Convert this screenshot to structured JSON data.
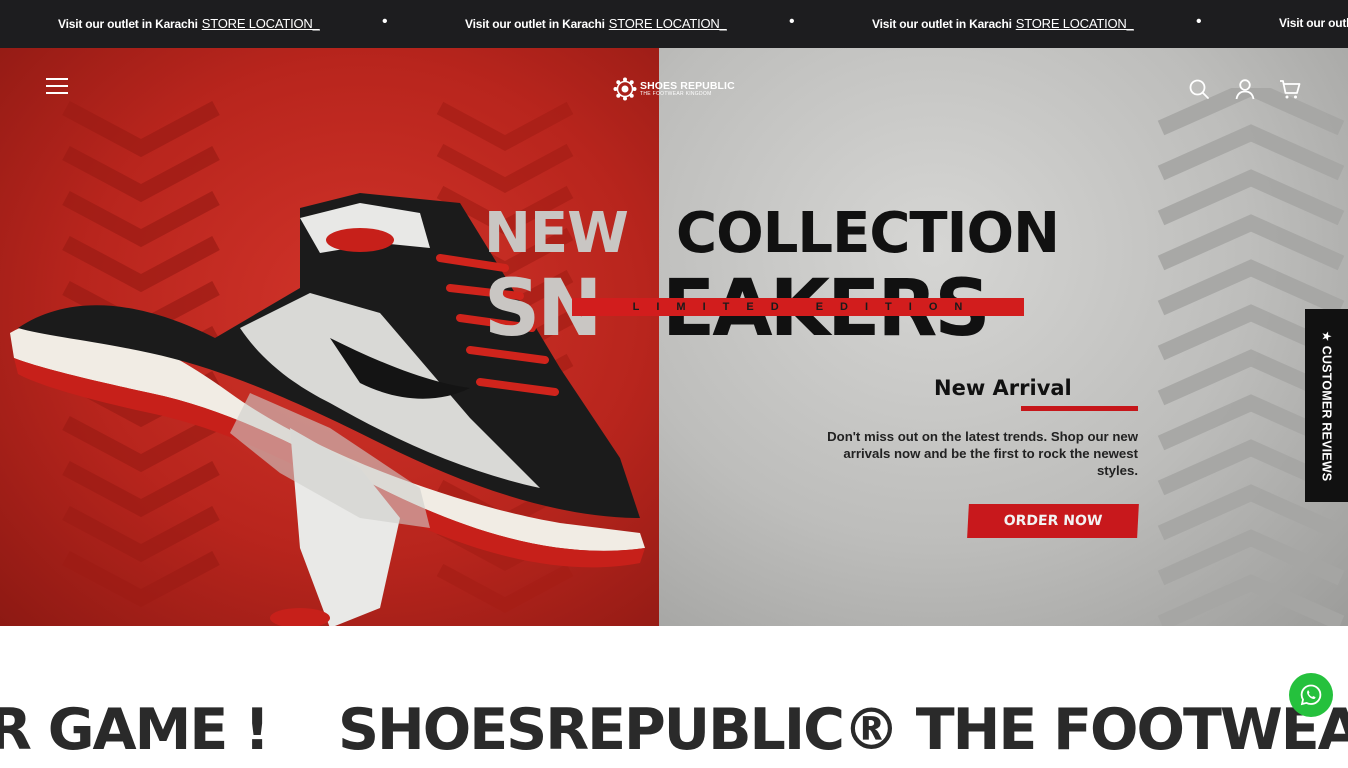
{
  "announcement": {
    "items": [
      {
        "text": "Visit our outlet in Karachi",
        "link": "STORE LOCATION_"
      },
      {
        "text": "Visit our outlet in Karachi",
        "link": "STORE LOCATION_"
      },
      {
        "text": "Visit our outlet in Karachi",
        "link": "STORE LOCATION_"
      },
      {
        "text": "Visit our outl",
        "link": ""
      }
    ],
    "separator": "•"
  },
  "header": {
    "logo_name": "SHOES REPUBLIC",
    "logo_tagline": "THE FOOTWEAR KINGDOM",
    "icons": [
      "menu-icon",
      "search-icon",
      "account-icon",
      "cart-icon"
    ]
  },
  "hero": {
    "line1_a": "NEW",
    "line1_b": "COLLECTION",
    "line2_a": "SN",
    "line2_b": "EAKERS",
    "ribbon": "LIMITED EDITION",
    "subheading": "New Arrival",
    "description": "Don't miss out on the latest trends. Shop our new arrivals now and be the first to rock the newest styles.",
    "cta": "ORDER NOW",
    "colors": {
      "left_panel": "#b8251d",
      "right_panel": "#bdbdbb",
      "accent": "#c8181c"
    }
  },
  "reviews_tab": {
    "label": "★ CUSTOMER REVIEWS"
  },
  "marquee": {
    "part1": "R GAME !",
    "part2": "SHOESREPUBLIC® THE FOOTWEAR KING"
  },
  "whatsapp": {
    "icon": "whatsapp-icon",
    "color": "#25c13d"
  }
}
